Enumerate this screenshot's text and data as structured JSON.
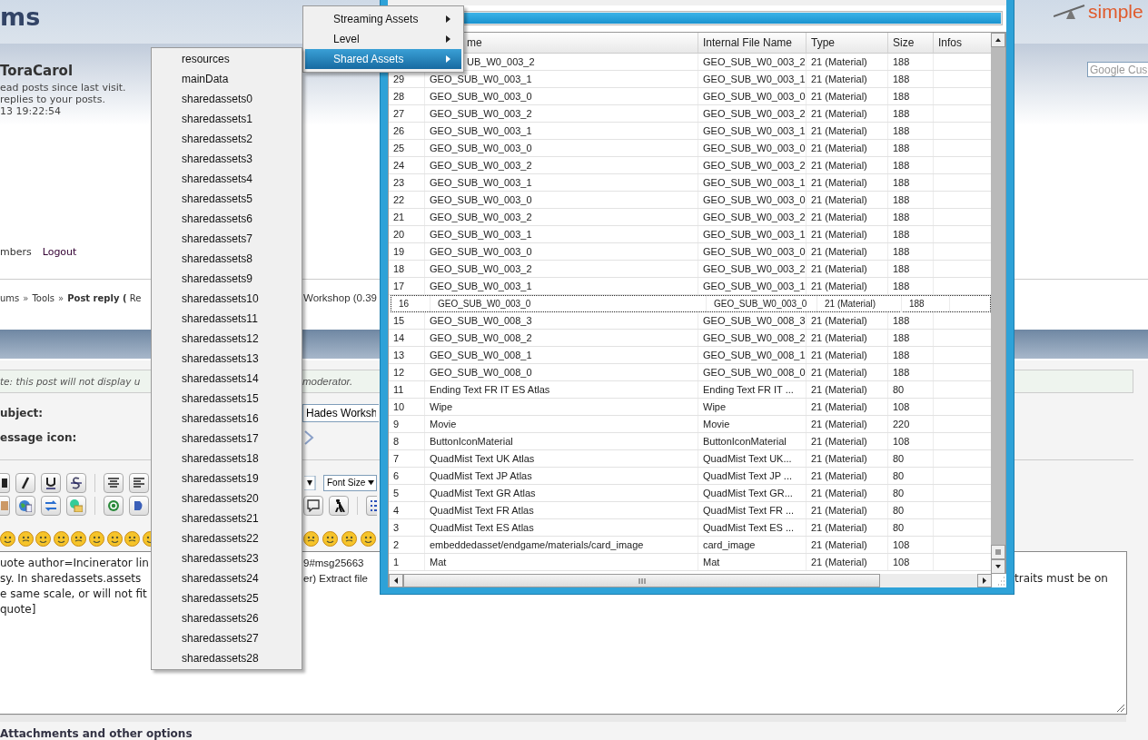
{
  "forum": {
    "header_title": "ms",
    "logo": "simple",
    "greeting": "ToraCarol",
    "info_lines": [
      "ead posts since last visit.",
      "replies to your posts.",
      "13 19:22:54"
    ],
    "search": {
      "placeholder": "Google Cus"
    },
    "nav_links": [
      "mbers",
      "Logout"
    ],
    "breadcrumb": {
      "links": [
        "ums",
        "»",
        "Tools",
        "»"
      ],
      "current": "**Post reply (** Re",
      "tail": "Workshop (0.39"
    },
    "note": [
      "te: this post will not display u",
      "moderator."
    ],
    "subject": {
      "label": "ubject:",
      "value": "Hades Worksh"
    },
    "message_icon": {
      "label": "essage icon:"
    },
    "font_size": "Font Size",
    "post_lines": [
      {
        "left": "uote author=Incinerator lin",
        "middle": "9#msg25663"
      },
      {
        "left": "sy. In sharedassets.assets",
        "middle": "er) Extract file",
        "right": "traits must be on"
      },
      {
        "left": "e same scale, or will not fit"
      },
      {
        "left": "quote]"
      }
    ],
    "attachments": "Attachments and other options"
  },
  "window": {
    "progress": {
      "level": 1
    },
    "columns": [
      "me",
      "Internal File Name",
      "Type",
      "Size",
      "Infos"
    ],
    "rows": [
      {
        "name": "UB_W0_003_2",
        "internal": "GEO_SUB_W0_003_2",
        "type": "21 (Material)",
        "size": "188",
        "selected": false
      },
      {
        "id": "29",
        "name": "GEO_SUB_W0_003_1",
        "internal": "GEO_SUB_W0_003_1",
        "type": "21 (Material)",
        "size": "188",
        "selected": false
      },
      {
        "id": "28",
        "name": "GEO_SUB_W0_003_0",
        "internal": "GEO_SUB_W0_003_0",
        "type": "21 (Material)",
        "size": "188",
        "selected": false
      },
      {
        "id": "27",
        "name": "GEO_SUB_W0_003_2",
        "internal": "GEO_SUB_W0_003_2",
        "type": "21 (Material)",
        "size": "188",
        "selected": false
      },
      {
        "id": "26",
        "name": "GEO_SUB_W0_003_1",
        "internal": "GEO_SUB_W0_003_1",
        "type": "21 (Material)",
        "size": "188",
        "selected": false
      },
      {
        "id": "25",
        "name": "GEO_SUB_W0_003_0",
        "internal": "GEO_SUB_W0_003_0",
        "type": "21 (Material)",
        "size": "188",
        "selected": false
      },
      {
        "id": "24",
        "name": "GEO_SUB_W0_003_2",
        "internal": "GEO_SUB_W0_003_2",
        "type": "21 (Material)",
        "size": "188",
        "selected": false
      },
      {
        "id": "23",
        "name": "GEO_SUB_W0_003_1",
        "internal": "GEO_SUB_W0_003_1",
        "type": "21 (Material)",
        "size": "188",
        "selected": false
      },
      {
        "id": "22",
        "name": "GEO_SUB_W0_003_0",
        "internal": "GEO_SUB_W0_003_0",
        "type": "21 (Material)",
        "size": "188",
        "selected": false
      },
      {
        "id": "21",
        "name": "GEO_SUB_W0_003_2",
        "internal": "GEO_SUB_W0_003_2",
        "type": "21 (Material)",
        "size": "188",
        "selected": false
      },
      {
        "id": "20",
        "name": "GEO_SUB_W0_003_1",
        "internal": "GEO_SUB_W0_003_1",
        "type": "21 (Material)",
        "size": "188",
        "selected": false
      },
      {
        "id": "19",
        "name": "GEO_SUB_W0_003_0",
        "internal": "GEO_SUB_W0_003_0",
        "type": "21 (Material)",
        "size": "188",
        "selected": false
      },
      {
        "id": "18",
        "name": "GEO_SUB_W0_003_2",
        "internal": "GEO_SUB_W0_003_2",
        "type": "21 (Material)",
        "size": "188",
        "selected": false
      },
      {
        "id": "17",
        "name": "GEO_SUB_W0_003_1",
        "internal": "GEO_SUB_W0_003_1",
        "type": "21 (Material)",
        "size": "188",
        "selected": false
      },
      {
        "id": "16",
        "name": "GEO_SUB_W0_003_0",
        "internal": "GEO_SUB_W0_003_0",
        "type": "21 (Material)",
        "size": "188",
        "selected": true
      },
      {
        "id": "15",
        "name": "GEO_SUB_W0_008_3",
        "internal": "GEO_SUB_W0_008_3",
        "type": "21 (Material)",
        "size": "188",
        "selected": false
      },
      {
        "id": "14",
        "name": "GEO_SUB_W0_008_2",
        "internal": "GEO_SUB_W0_008_2",
        "type": "21 (Material)",
        "size": "188",
        "selected": false
      },
      {
        "id": "13",
        "name": "GEO_SUB_W0_008_1",
        "internal": "GEO_SUB_W0_008_1",
        "type": "21 (Material)",
        "size": "188",
        "selected": false
      },
      {
        "id": "12",
        "name": "GEO_SUB_W0_008_0",
        "internal": "GEO_SUB_W0_008_0",
        "type": "21 (Material)",
        "size": "188",
        "selected": false
      },
      {
        "id": "11",
        "name": "Ending Text FR IT ES Atlas",
        "internal": "Ending Text FR IT ...",
        "type": "21 (Material)",
        "size": "80",
        "selected": false
      },
      {
        "id": "10",
        "name": "Wipe",
        "internal": "Wipe",
        "type": "21 (Material)",
        "size": "108",
        "selected": false
      },
      {
        "id": "9",
        "name": "Movie",
        "internal": "Movie",
        "type": "21 (Material)",
        "size": "220",
        "selected": false
      },
      {
        "id": "8",
        "name": "ButtonIconMaterial",
        "internal": "ButtonIconMaterial",
        "type": "21 (Material)",
        "size": "108",
        "selected": false
      },
      {
        "id": "7",
        "name": "QuadMist Text UK Atlas",
        "internal": "QuadMist Text UK...",
        "type": "21 (Material)",
        "size": "80",
        "selected": false
      },
      {
        "id": "6",
        "name": "QuadMist Text JP Atlas",
        "internal": "QuadMist Text JP ...",
        "type": "21 (Material)",
        "size": "80",
        "selected": false
      },
      {
        "id": "5",
        "name": "QuadMist Text GR Atlas",
        "internal": "QuadMist Text GR...",
        "type": "21 (Material)",
        "size": "80",
        "selected": false
      },
      {
        "id": "4",
        "name": "QuadMist Text FR Atlas",
        "internal": "QuadMist Text FR ...",
        "type": "21 (Material)",
        "size": "80",
        "selected": false
      },
      {
        "id": "3",
        "name": "QuadMist Text ES Atlas",
        "internal": "QuadMist Text ES ...",
        "type": "21 (Material)",
        "size": "80",
        "selected": false
      },
      {
        "id": "2",
        "name": "embeddedasset/endgame/materials/card_image",
        "internal": "card_image",
        "type": "21 (Material)",
        "size": "108",
        "selected": false
      },
      {
        "id": "1",
        "name": "Mat",
        "internal": "Mat",
        "type": "21 (Material)",
        "size": "108",
        "selected": false
      }
    ]
  },
  "menu": {
    "items": [
      {
        "label": "Streaming Assets",
        "selected": false
      },
      {
        "label": "Level",
        "selected": false
      },
      {
        "label": "Shared Assets",
        "selected": true
      }
    ]
  },
  "submenu": {
    "items": [
      "resources",
      "mainData",
      "sharedassets0",
      "sharedassets1",
      "sharedassets2",
      "sharedassets3",
      "sharedassets4",
      "sharedassets5",
      "sharedassets6",
      "sharedassets7",
      "sharedassets8",
      "sharedassets9",
      "sharedassets10",
      "sharedassets11",
      "sharedassets12",
      "sharedassets13",
      "sharedassets14",
      "sharedassets15",
      "sharedassets16",
      "sharedassets17",
      "sharedassets18",
      "sharedassets19",
      "sharedassets20",
      "sharedassets21",
      "sharedassets22",
      "sharedassets23",
      "sharedassets24",
      "sharedassets25",
      "sharedassets26",
      "sharedassets27",
      "sharedassets28"
    ]
  }
}
